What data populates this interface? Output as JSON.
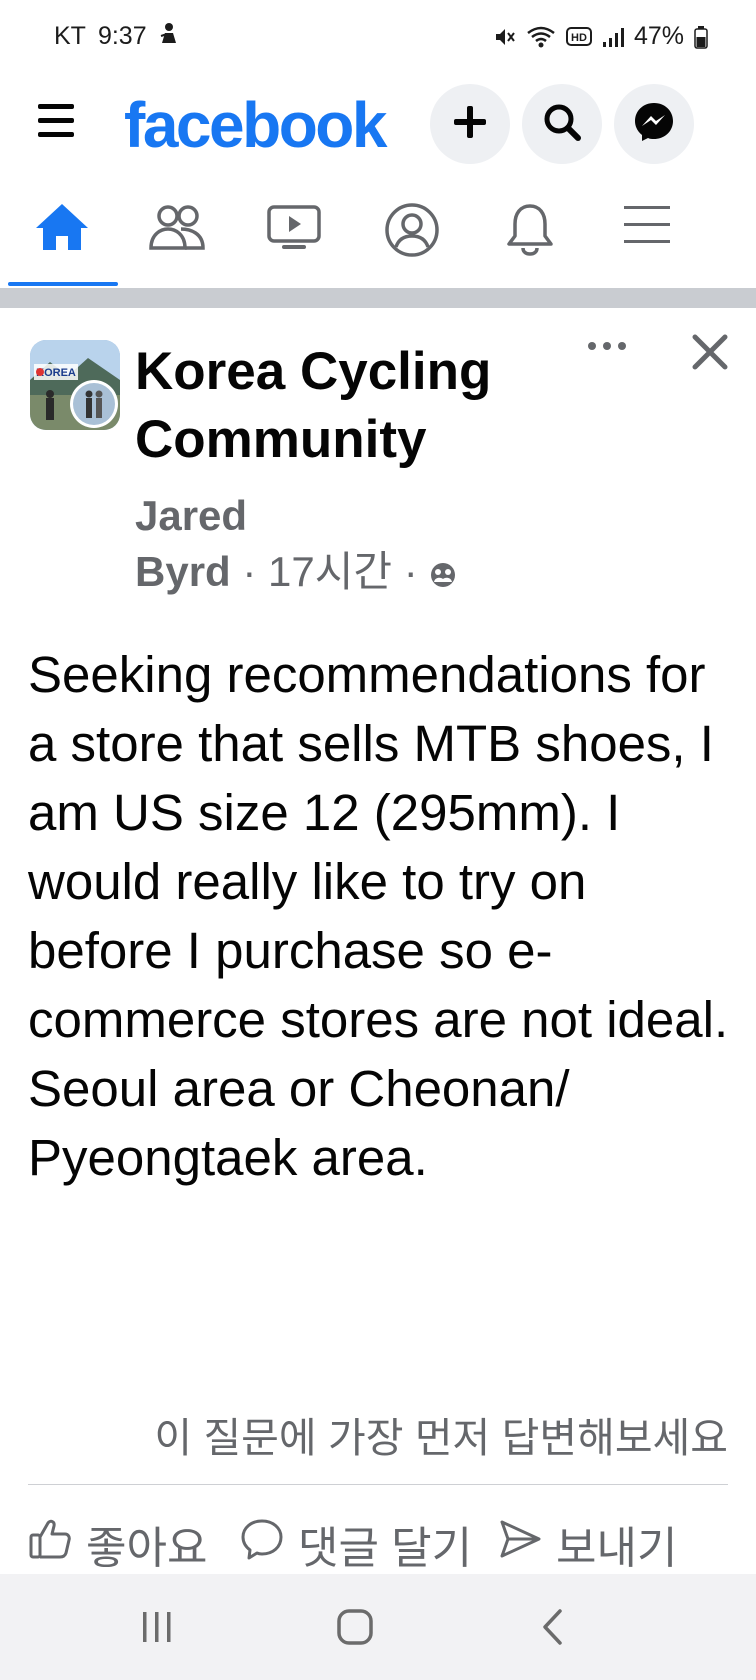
{
  "status_bar": {
    "carrier": "KT",
    "time": "9:37",
    "battery_percent": "47%",
    "icons": [
      "person-icon",
      "mute-icon",
      "wifi-icon",
      "hd-icon",
      "signal-icon",
      "battery-icon"
    ]
  },
  "header": {
    "logo": "facebook",
    "brand_color": "#1877f2",
    "buttons": [
      "menu-icon",
      "plus-icon",
      "search-icon",
      "messenger-icon"
    ]
  },
  "tabs": [
    {
      "name": "home",
      "icon": "home-icon",
      "active": true
    },
    {
      "name": "friends",
      "icon": "friends-icon",
      "active": false
    },
    {
      "name": "video",
      "icon": "video-icon",
      "active": false
    },
    {
      "name": "profile",
      "icon": "profile-icon",
      "active": false
    },
    {
      "name": "notifications",
      "icon": "bell-icon",
      "active": false
    },
    {
      "name": "menu",
      "icon": "hamburger-icon",
      "active": false
    }
  ],
  "post": {
    "group_name": "Korea Cycling Community",
    "author_first": "Jared",
    "author_last": "Byrd",
    "separator": " · ",
    "time_ago": "17시간",
    "privacy_icon": "group-icon",
    "body": "Seeking recommendations for a store that sells MTB shoes, I am US size 12 (295mm). I would really like to try on before I purchase so e-commerce stores are not ideal. Seoul area or Cheonan/ Pyeongtaek area.",
    "answer_prompt": "이 질문에 가장 먼저 답변해보세요",
    "actions": {
      "like": "좋아요",
      "comment": "댓글 달기",
      "send": "보내기"
    }
  },
  "system_nav": [
    "recents-icon",
    "home-button-icon",
    "back-icon"
  ]
}
